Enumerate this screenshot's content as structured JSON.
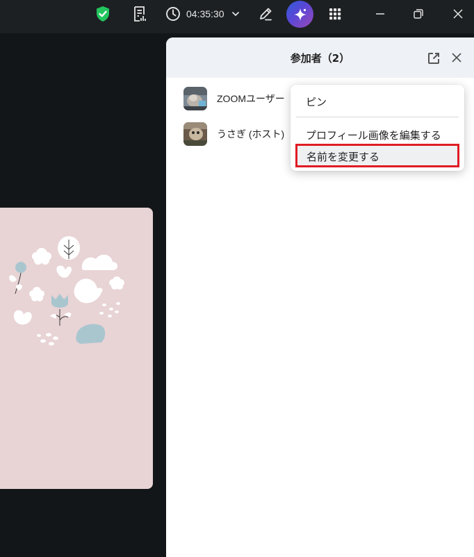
{
  "toolbar": {
    "timer": "04:35:30",
    "icons": [
      "shield-check-icon",
      "transcript-icon",
      "clock-icon",
      "chevron-down-icon",
      "pencil-icon",
      "ai-sparkle-icon",
      "apps-grid-icon",
      "minimize-icon",
      "restore-icon",
      "close-icon"
    ],
    "security_color": "#22c55e"
  },
  "panel": {
    "title": "参加者（2）",
    "popout_icon": "popout-icon",
    "close_icon": "close-icon",
    "participants": [
      {
        "name": "ZOOMユーザー"
      },
      {
        "name": "うさぎ (ホスト)"
      }
    ]
  },
  "context_menu": {
    "items": [
      "ピン",
      "プロフィール画像を編集する",
      "名前を変更する"
    ],
    "highlight_color": "#e01b24"
  }
}
